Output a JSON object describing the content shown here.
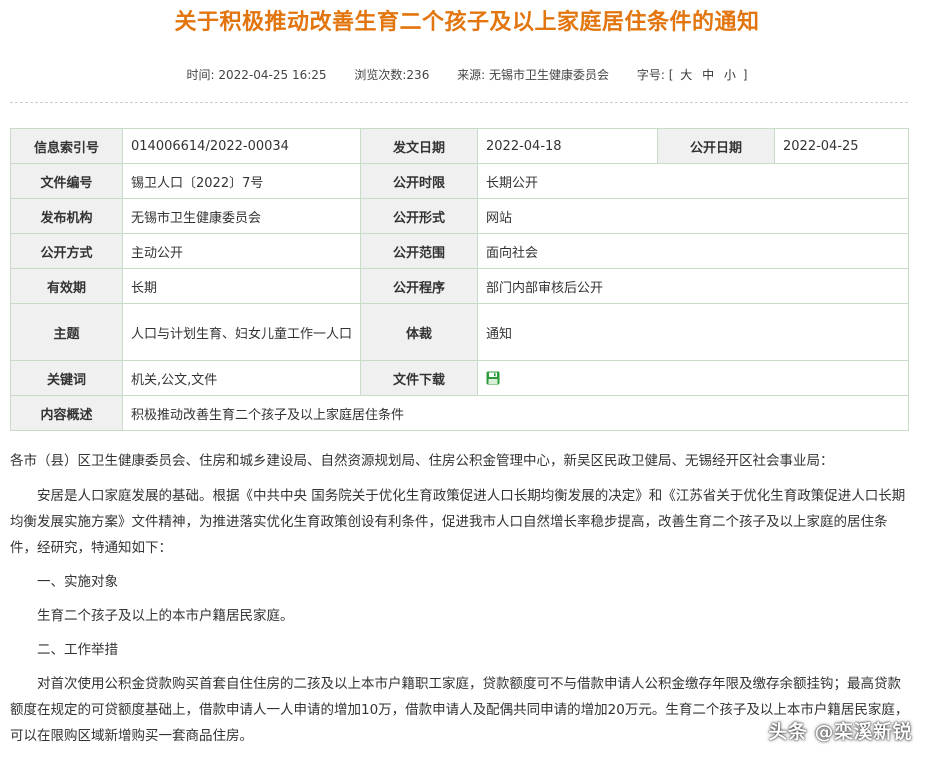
{
  "title": "关于积极推动改善生育二个孩子及以上家庭居住条件的通知",
  "meta": {
    "time": "时间: 2022-04-25 16:25",
    "views": "浏览次数:236",
    "source": "来源: 无锡市卫生健康委员会",
    "font_size_label": "字号:",
    "bracket_open": "[",
    "size_large": "大",
    "size_medium": "中",
    "size_small": "小",
    "bracket_close": "]"
  },
  "info": {
    "index_no_label": "信息索引号",
    "index_no": "014006614/2022-00034",
    "issue_date_label": "发文日期",
    "issue_date": "2022-04-18",
    "publish_date_label": "公开日期",
    "publish_date": "2022-04-25",
    "doc_no_label": "文件编号",
    "doc_no": "锡卫人口〔2022〕7号",
    "disclosure_time_label": "公开时限",
    "disclosure_time": "长期公开",
    "publisher_label": "发布机构",
    "publisher": "无锡市卫生健康委员会",
    "disclosure_form_label": "公开形式",
    "disclosure_form": "网站",
    "disclosure_method_label": "公开方式",
    "disclosure_method": "主动公开",
    "disclosure_scope_label": "公开范围",
    "disclosure_scope": "面向社会",
    "validity_label": "有效期",
    "validity": "长期",
    "disclosure_procedure_label": "公开程序",
    "disclosure_procedure": "部门内部审核后公开",
    "topic_label": "主题",
    "topic": "人口与计划生育、妇女儿童工作一人口",
    "genre_label": "体裁",
    "genre": "通知",
    "keywords_label": "关键词",
    "keywords": "机关,公文,文件",
    "download_label": "文件下载",
    "summary_label": "内容概述",
    "summary": "积极推动改善生育二个孩子及以上家庭居住条件"
  },
  "body": {
    "addressee": "各市（县）区卫生健康委员会、住房和城乡建设局、自然资源规划局、住房公积金管理中心，新吴区民政卫健局、无锡经开区社会事业局：",
    "para1": "安居是人口家庭发展的基础。根据《中共中央 国务院关于优化生育政策促进人口长期均衡发展的决定》和《江苏省关于优化生育政策促进人口长期均衡发展实施方案》文件精神，为推进落实优化生育政策创设有利条件，促进我市人口自然增长率稳步提高，改善生育二个孩子及以上家庭的居住条件，经研究，特通知如下：",
    "section1": "一、实施对象",
    "section1_text": "生育二个孩子及以上的本市户籍居民家庭。",
    "section2": "二、工作举措",
    "para2": "对首次使用公积金贷款购买首套自住住房的二孩及以上本市户籍职工家庭，贷款额度可不与借款申请人公积金缴存年限及缴存余额挂钩；最高贷款额度在规定的可贷额度基础上，借款申请人一人申请的增加10万，借款申请人及配偶共同申请的增加20万元。生育二个孩子及以上本市户籍居民家庭，可以在限购区域新增购买一套商品住房。"
  },
  "watermark": "头条 @栾溪新锐",
  "colors": {
    "title": "#e2750e",
    "label_bg": "#f0f0f0",
    "border": "#c8dcc8",
    "download_icon": "#2e9b3a"
  }
}
